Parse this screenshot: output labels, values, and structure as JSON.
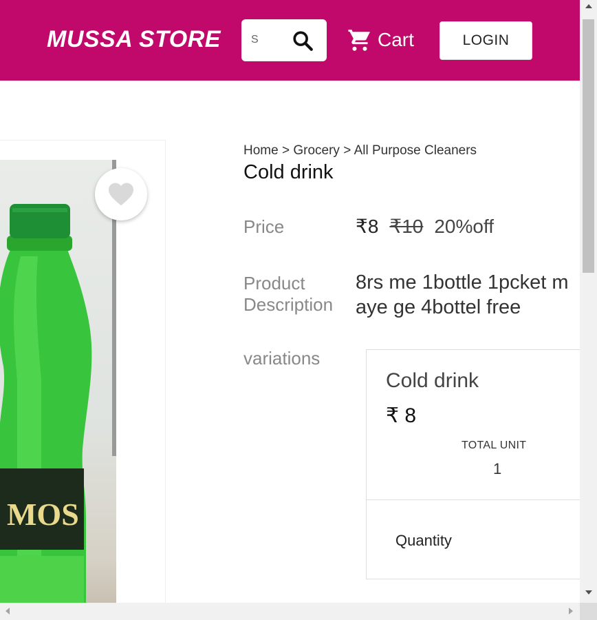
{
  "header": {
    "logo": "MUSSA STORE",
    "search_value": "S",
    "cart_label": "Cart",
    "login_label": "LOGIN",
    "brand_color": "#c0096a"
  },
  "product": {
    "breadcrumb": [
      "Home",
      "Grocery",
      "All Purpose Cleaners"
    ],
    "breadcrumb_separator": ">",
    "title": "Cold drink",
    "price_label": "Price",
    "price": "₹8",
    "mrp": "₹10",
    "discount": "20%off",
    "description_label_line1": "Product",
    "description_label_line2": "Description",
    "description_line1": "8rs me 1bottle 1pcket m",
    "description_line2": "aye ge 4bottel free",
    "variations_label": "variations",
    "image_bottle_label": "MOS"
  },
  "variation": {
    "name": "Cold drink",
    "price": "₹ 8",
    "total_unit_label": "TOTAL UNIT",
    "total_unit_value": "1",
    "quantity_label": "Quantity"
  },
  "icons": {
    "search": "search-icon",
    "cart": "cart-icon",
    "wishlist": "heart-icon"
  }
}
